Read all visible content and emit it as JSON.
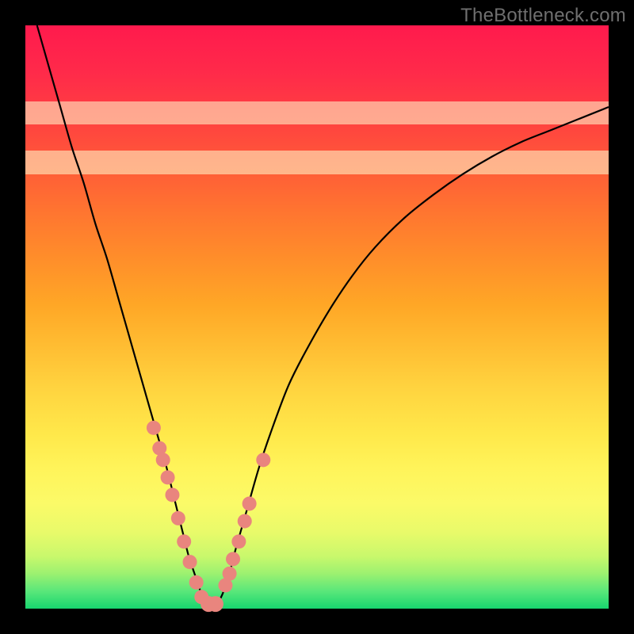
{
  "watermark": "TheBottleneck.com",
  "colors": {
    "frame": "#000000",
    "marker": "#e9857e",
    "curve": "#000000"
  },
  "chart_data": {
    "type": "line",
    "title": "",
    "xlabel": "",
    "ylabel": "",
    "xlim": [
      0,
      100
    ],
    "ylim": [
      0,
      100
    ],
    "grid": false,
    "legend": false,
    "series": [
      {
        "name": "bottleneck-curve",
        "x": [
          2,
          4,
          6,
          8,
          10,
          12,
          14,
          16,
          18,
          20,
          22,
          24,
          26,
          27,
          28,
          29,
          30,
          30.5,
          31,
          32,
          33,
          34,
          35,
          36,
          38,
          40,
          42,
          45,
          48,
          52,
          56,
          60,
          65,
          70,
          75,
          80,
          85,
          90,
          95,
          100
        ],
        "y": [
          100,
          93,
          86,
          79,
          73,
          66,
          60,
          53,
          46,
          39,
          32,
          25,
          17,
          13,
          9,
          6,
          3,
          1,
          0.5,
          0.5,
          1,
          3,
          6,
          10,
          17,
          24,
          30,
          38,
          44,
          51,
          57,
          62,
          67,
          71,
          74.5,
          77.5,
          80,
          82,
          84,
          86
        ]
      }
    ],
    "markers": {
      "x": [
        22.0,
        23.0,
        23.6,
        24.4,
        25.2,
        26.2,
        27.2,
        28.2,
        29.3,
        30.2,
        31.4,
        32.6,
        34.3,
        35.0,
        35.6,
        36.6,
        37.6,
        38.4,
        40.8
      ],
      "y": [
        31.0,
        27.5,
        25.5,
        22.5,
        19.5,
        15.5,
        11.5,
        8.0,
        4.5,
        2.0,
        0.8,
        0.8,
        4.0,
        6.0,
        8.5,
        11.5,
        15.0,
        18.0,
        25.5
      ],
      "r": [
        9,
        9,
        9,
        9,
        9,
        9,
        9,
        9,
        9,
        9,
        10,
        10,
        9,
        9,
        9,
        9,
        9,
        9,
        9
      ]
    },
    "pale_bands": [
      {
        "y0": 74.5,
        "y1": 78.5
      },
      {
        "y0": 83.0,
        "y1": 87.0
      }
    ]
  }
}
